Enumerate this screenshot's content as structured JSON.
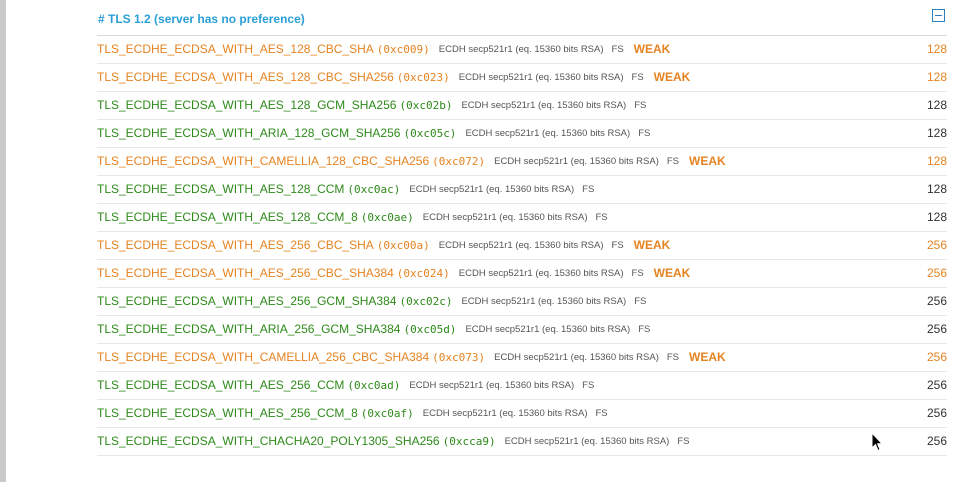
{
  "section": {
    "title": "# TLS 1.2 (server has no preference)"
  },
  "colors": {
    "weak": "#e68321",
    "strong": "#2d8a19",
    "header": "#2a9fd6"
  },
  "ciphers": [
    {
      "name": "TLS_ECDHE_ECDSA_WITH_AES_128_CBC_SHA",
      "code": "(0xc009)",
      "info": "ECDH secp521r1 (eq. 15360 bits RSA)",
      "fs": "FS",
      "weak": "WEAK",
      "bits": "128"
    },
    {
      "name": "TLS_ECDHE_ECDSA_WITH_AES_128_CBC_SHA256",
      "code": "(0xc023)",
      "info": "ECDH secp521r1 (eq. 15360 bits RSA)",
      "fs": "FS",
      "weak": "WEAK",
      "bits": "128"
    },
    {
      "name": "TLS_ECDHE_ECDSA_WITH_AES_128_GCM_SHA256",
      "code": "(0xc02b)",
      "info": "ECDH secp521r1 (eq. 15360 bits RSA)",
      "fs": "FS",
      "weak": "",
      "bits": "128"
    },
    {
      "name": "TLS_ECDHE_ECDSA_WITH_ARIA_128_GCM_SHA256",
      "code": "(0xc05c)",
      "info": "ECDH secp521r1 (eq. 15360 bits RSA)",
      "fs": "FS",
      "weak": "",
      "bits": "128"
    },
    {
      "name": "TLS_ECDHE_ECDSA_WITH_CAMELLIA_128_CBC_SHA256",
      "code": "(0xc072)",
      "info": "ECDH secp521r1 (eq. 15360 bits RSA)",
      "fs": "FS",
      "weak": "WEAK",
      "bits": "128"
    },
    {
      "name": "TLS_ECDHE_ECDSA_WITH_AES_128_CCM",
      "code": "(0xc0ac)",
      "info": "ECDH secp521r1 (eq. 15360 bits RSA)",
      "fs": "FS",
      "weak": "",
      "bits": "128"
    },
    {
      "name": "TLS_ECDHE_ECDSA_WITH_AES_128_CCM_8",
      "code": "(0xc0ae)",
      "info": "ECDH secp521r1 (eq. 15360 bits RSA)",
      "fs": "FS",
      "weak": "",
      "bits": "128"
    },
    {
      "name": "TLS_ECDHE_ECDSA_WITH_AES_256_CBC_SHA",
      "code": "(0xc00a)",
      "info": "ECDH secp521r1 (eq. 15360 bits RSA)",
      "fs": "FS",
      "weak": "WEAK",
      "bits": "256"
    },
    {
      "name": "TLS_ECDHE_ECDSA_WITH_AES_256_CBC_SHA384",
      "code": "(0xc024)",
      "info": "ECDH secp521r1 (eq. 15360 bits RSA)",
      "fs": "FS",
      "weak": "WEAK",
      "bits": "256"
    },
    {
      "name": "TLS_ECDHE_ECDSA_WITH_AES_256_GCM_SHA384",
      "code": "(0xc02c)",
      "info": "ECDH secp521r1 (eq. 15360 bits RSA)",
      "fs": "FS",
      "weak": "",
      "bits": "256"
    },
    {
      "name": "TLS_ECDHE_ECDSA_WITH_ARIA_256_GCM_SHA384",
      "code": "(0xc05d)",
      "info": "ECDH secp521r1 (eq. 15360 bits RSA)",
      "fs": "FS",
      "weak": "",
      "bits": "256"
    },
    {
      "name": "TLS_ECDHE_ECDSA_WITH_CAMELLIA_256_CBC_SHA384",
      "code": "(0xc073)",
      "info": "ECDH secp521r1 (eq. 15360 bits RSA)",
      "fs": "FS",
      "weak": "WEAK",
      "bits": "256"
    },
    {
      "name": "TLS_ECDHE_ECDSA_WITH_AES_256_CCM",
      "code": "(0xc0ad)",
      "info": "ECDH secp521r1 (eq. 15360 bits RSA)",
      "fs": "FS",
      "weak": "",
      "bits": "256"
    },
    {
      "name": "TLS_ECDHE_ECDSA_WITH_AES_256_CCM_8",
      "code": "(0xc0af)",
      "info": "ECDH secp521r1 (eq. 15360 bits RSA)",
      "fs": "FS",
      "weak": "",
      "bits": "256"
    },
    {
      "name": "TLS_ECDHE_ECDSA_WITH_CHACHA20_POLY1305_SHA256",
      "code": "(0xcca9)",
      "info": "ECDH secp521r1 (eq. 15360 bits RSA)",
      "fs": "FS",
      "weak": "",
      "bits": "256"
    }
  ]
}
